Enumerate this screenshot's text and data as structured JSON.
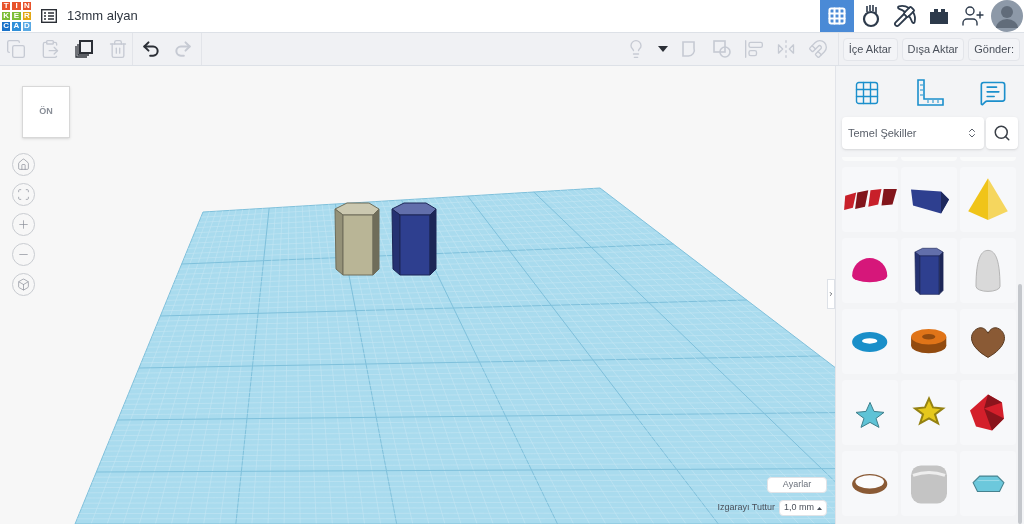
{
  "logo": {
    "letters": [
      {
        "char": "T",
        "color": "#e8532b"
      },
      {
        "char": "I",
        "color": "#e8532b"
      },
      {
        "char": "N",
        "color": "#e8532b"
      },
      {
        "char": "K",
        "color": "#7cbd36"
      },
      {
        "char": "E",
        "color": "#7cbd36"
      },
      {
        "char": "R",
        "color": "#e2a714"
      },
      {
        "char": "C",
        "color": "#1a72c9"
      },
      {
        "char": "A",
        "color": "#2f8fd8"
      },
      {
        "char": "D",
        "color": "#5aa9e3"
      }
    ]
  },
  "design_title": "13mm alyan",
  "nav": [
    {
      "kind": "grid",
      "selected": true
    },
    {
      "kind": "circuits",
      "selected": false
    },
    {
      "kind": "pickaxe",
      "selected": false
    },
    {
      "kind": "bricks",
      "selected": false
    },
    {
      "kind": "add-user",
      "selected": false
    },
    {
      "kind": "avatar",
      "selected": false
    }
  ],
  "toolbar": [
    {
      "kind": "copy",
      "disabled": true
    },
    {
      "kind": "paste",
      "disabled": true
    },
    {
      "kind": "duplicate",
      "disabled": false
    },
    {
      "kind": "delete",
      "disabled": true
    },
    {
      "kind": "undo",
      "disabled": false
    },
    {
      "kind": "redo",
      "disabled": true
    }
  ],
  "toolbar_right": [
    {
      "kind": "light",
      "disabled": true
    },
    {
      "kind": "caret",
      "disabled": false
    },
    {
      "kind": "group",
      "disabled": true
    },
    {
      "kind": "ungroup",
      "disabled": true
    },
    {
      "kind": "align",
      "disabled": true
    },
    {
      "kind": "mirror",
      "disabled": true
    },
    {
      "kind": "magnet",
      "disabled": true
    }
  ],
  "actions": [
    "İçe Aktar",
    "Dışa Aktar",
    "Gönder:"
  ],
  "view_cube": {
    "label": "ÖN"
  },
  "view_controls": [
    {
      "kind": "home"
    },
    {
      "kind": "fit"
    },
    {
      "kind": "zoom-in"
    },
    {
      "kind": "zoom-out"
    },
    {
      "kind": "perspective"
    }
  ],
  "scene_objects": [
    {
      "kind": "hex-prism",
      "color": "#b9b596"
    },
    {
      "kind": "hex-prism",
      "color": "#2e3f8f"
    }
  ],
  "settings_button": "Ayarlar",
  "snap_grid": {
    "label": "Izgarayı Tuttur",
    "value": "1,0 mm"
  },
  "panel_tools": [
    {
      "kind": "workplane"
    },
    {
      "kind": "ruler"
    },
    {
      "kind": "notes"
    }
  ],
  "library": {
    "value": "Temel Şekiller"
  },
  "shapes": [
    {
      "kind": "text",
      "color": "#c8202a"
    },
    {
      "kind": "roof",
      "color": "#2e3f8f"
    },
    {
      "kind": "pyramid",
      "color": "#f0c419"
    },
    {
      "kind": "half-sphere",
      "color": "#d6177a"
    },
    {
      "kind": "hex-prism",
      "color": "#2e3f8f"
    },
    {
      "kind": "paraboloid",
      "color": "#d9d9d9"
    },
    {
      "kind": "torus",
      "color": "#1a8fc9"
    },
    {
      "kind": "tube",
      "color": "#e07418"
    },
    {
      "kind": "heart",
      "color": "#8a5a35"
    },
    {
      "kind": "star",
      "color": "#5fc3d6"
    },
    {
      "kind": "star-prism",
      "color": "#e5c81c"
    },
    {
      "kind": "icosahedron",
      "color": "#d41f2b"
    },
    {
      "kind": "ring",
      "color": "#8a5a35"
    },
    {
      "kind": "round-box",
      "color": "#c4c4c4"
    },
    {
      "kind": "gem",
      "color": "#6cc8dc"
    }
  ]
}
